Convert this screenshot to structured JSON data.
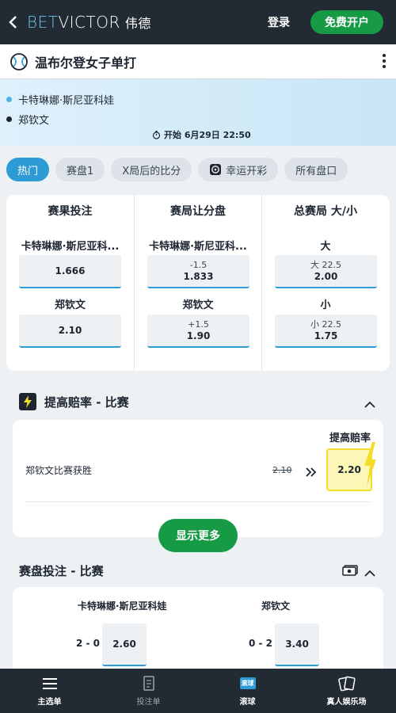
{
  "header": {
    "logo_bet": "BET",
    "logo_victor": "VICTOR",
    "logo_cn": "伟德",
    "login_label": "登录",
    "signup_label": "免费开户"
  },
  "event": {
    "title": "温布尔登女子单打"
  },
  "scoreboard": {
    "player1": "卡特琳娜·斯尼亚科娃",
    "player2": "郑钦文",
    "start_time": "开始 6月29日 22:50",
    "player1_dot_color": "#4fb3e6",
    "player2_dot_color": "#1c2530"
  },
  "tabs": [
    {
      "label": "热门",
      "active": true
    },
    {
      "label": "赛盘1"
    },
    {
      "label": "X局后的比分"
    },
    {
      "label": "幸运开彩",
      "icon": "lucky-draw-icon"
    },
    {
      "label": "所有盘口"
    }
  ],
  "markets": {
    "match_result": {
      "title": "赛果投注",
      "sel1_label": "卡特琳娜·斯尼亚科...",
      "sel1_odd": "1.666",
      "sel2_label": "郑钦文",
      "sel2_odd": "2.10"
    },
    "game_handicap": {
      "title": "赛局让分盘",
      "sel1_label": "卡特琳娜·斯尼亚科...",
      "sel1_line": "-1.5",
      "sel1_odd": "1.833",
      "sel2_label": "郑钦文",
      "sel2_line": "+1.5",
      "sel2_odd": "1.90"
    },
    "total_games": {
      "title": "总赛局 大/小",
      "sel1_label": "大",
      "sel1_line": "大 22.5",
      "sel1_odd": "2.00",
      "sel2_label": "小",
      "sel2_line": "小 22.5",
      "sel2_odd": "1.75"
    }
  },
  "boost": {
    "section_title": "提高赔率 - 比赛",
    "label": "提高赔率",
    "selection": "郑钦文比赛获胜",
    "old_odd": "2.10",
    "new_odd": "2.20",
    "show_more": "显示更多",
    "boost_color": "#f3dc2a"
  },
  "correct_score": {
    "section_title": "赛盘投注 - 比赛",
    "player1": "卡特琳娜·斯尼亚科娃",
    "player2": "郑钦文",
    "p1_score": "2 - 0",
    "p1_odd": "2.60",
    "p2_score": "0 - 2",
    "p2_odd": "3.40"
  },
  "bottom_nav": [
    {
      "label": "主选单",
      "icon": "menu-icon"
    },
    {
      "label": "投注单",
      "icon": "betslip-icon"
    },
    {
      "label": "滚球",
      "icon": "inplay-icon",
      "badge": "滚球"
    },
    {
      "label": "真人娱乐场",
      "icon": "cards-icon"
    }
  ]
}
